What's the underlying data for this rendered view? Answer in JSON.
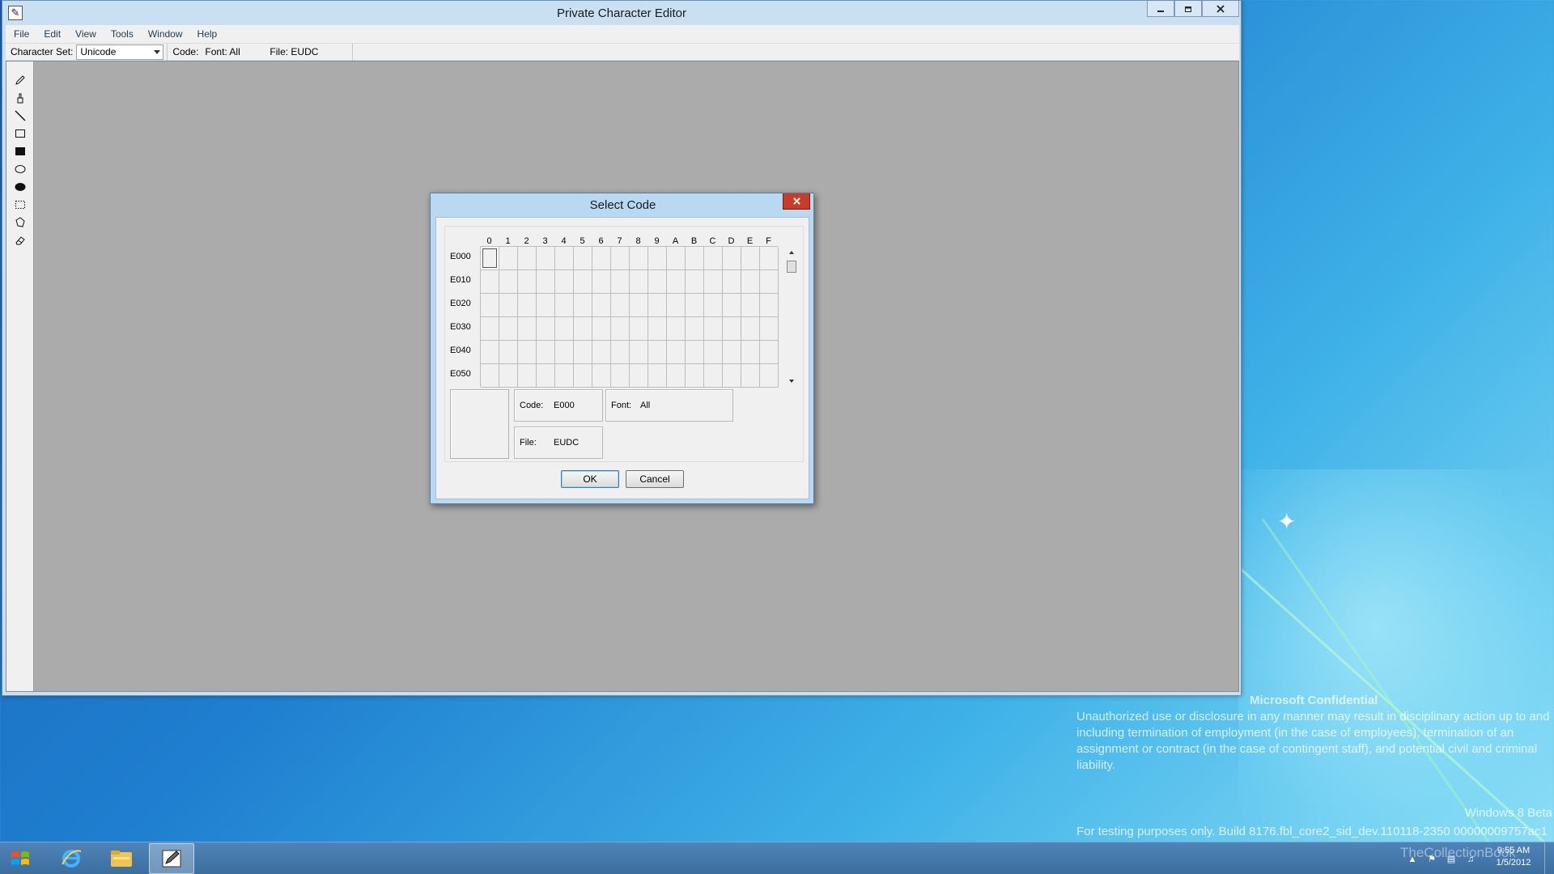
{
  "window": {
    "title": "Private Character Editor",
    "menu": [
      "File",
      "Edit",
      "View",
      "Tools",
      "Window",
      "Help"
    ],
    "toolbar": {
      "charset_label": "Character Set:",
      "charset_value": "Unicode",
      "code_label": "Code:",
      "font_label": "Font: All",
      "file_label": "File: EUDC"
    },
    "tools": [
      "pencil-icon",
      "brush-icon",
      "line-icon",
      "hollow-rectangle-icon",
      "filled-rectangle-icon",
      "hollow-ellipse-icon",
      "filled-ellipse-icon",
      "rectangular-selection-icon",
      "freeform-selection-icon",
      "eraser-icon"
    ]
  },
  "dialog": {
    "title": "Select Code",
    "columns": [
      "0",
      "1",
      "2",
      "3",
      "4",
      "5",
      "6",
      "7",
      "8",
      "9",
      "A",
      "B",
      "C",
      "D",
      "E",
      "F"
    ],
    "rows": [
      "E000",
      "E010",
      "E020",
      "E030",
      "E040",
      "E050"
    ],
    "selected_cell": {
      "row": 0,
      "col": 0
    },
    "code_label": "Code:",
    "code_value": "E000",
    "font_label": "Font:",
    "font_value": "All",
    "file_label": "File:",
    "file_value": "EUDC",
    "ok_label": "OK",
    "cancel_label": "Cancel"
  },
  "watermark": {
    "title": "Microsoft Confidential",
    "text": "Unauthorized use or disclosure in any manner may result in disciplinary action up to and including termination of employment (in the case of employees), termination of an assignment or contract (in the case of contingent staff), and potential civil and criminal liability.",
    "edition": "Windows 8 Beta",
    "build": "For testing purposes only. Build 8176.fbl_core2_sid_dev.110118-2350 00000009757ac1"
  },
  "taskbar": {
    "apps": [
      "start-button",
      "internet-explorer-icon",
      "file-explorer-icon",
      "private-character-editor-icon"
    ],
    "clock_time": "9:55 AM",
    "clock_date": "1/5/2012",
    "brand": "TheCollectionBook"
  }
}
